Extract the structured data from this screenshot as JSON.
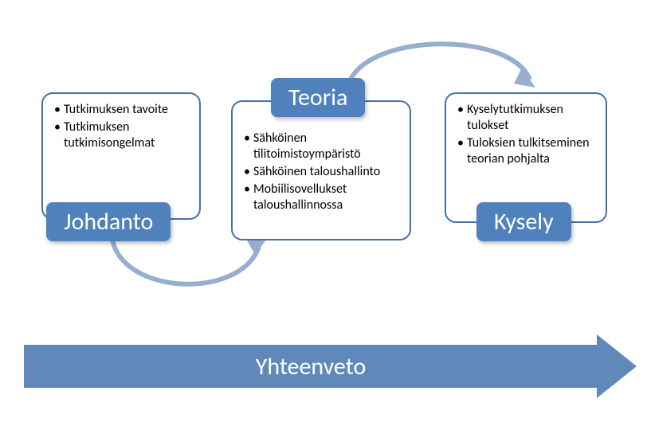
{
  "stages": {
    "johdanto": {
      "title": "Johdanto",
      "bullets": [
        "Tutkimuksen tavoite",
        "Tutkimuksen tutkimisongelmat"
      ]
    },
    "teoria": {
      "title": "Teoria",
      "bullets": [
        "Sähköinen tilitoimistoympäristö",
        "Sähköinen taloushallinto",
        "Mobiilisovellukset taloushallinnossa"
      ]
    },
    "kysely": {
      "title": "Kysely",
      "bullets": [
        "Kyselytutkimuksen tulokset",
        "Tuloksien tulkitseminen teorian pohjalta"
      ]
    }
  },
  "summary_arrow_label": "Yhteenveto"
}
